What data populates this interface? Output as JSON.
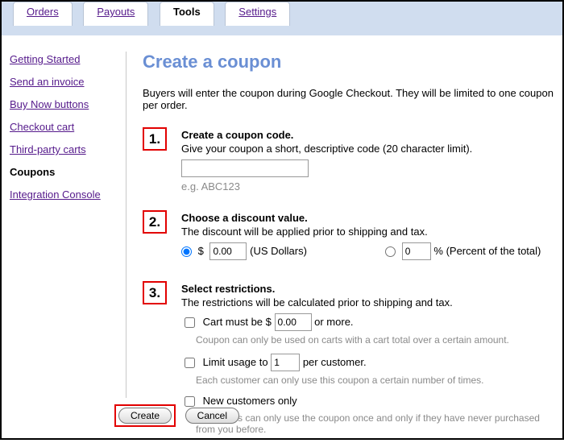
{
  "tabs": {
    "orders": "Orders",
    "payouts": "Payouts",
    "tools": "Tools",
    "settings": "Settings",
    "active": "tools"
  },
  "sidebar": {
    "items": [
      {
        "label": "Getting Started",
        "key": "getting-started"
      },
      {
        "label": "Send an invoice",
        "key": "send-invoice"
      },
      {
        "label": "Buy Now buttons",
        "key": "buy-now"
      },
      {
        "label": "Checkout cart",
        "key": "checkout-cart"
      },
      {
        "label": "Third-party carts",
        "key": "third-party"
      },
      {
        "label": "Coupons",
        "key": "coupons"
      },
      {
        "label": "Integration Console",
        "key": "integration"
      }
    ],
    "active": "coupons"
  },
  "page": {
    "title": "Create a coupon",
    "intro": "Buyers will enter the coupon during Google Checkout. They will be limited to one coupon per order."
  },
  "step1": {
    "num": "1.",
    "head": "Create a coupon code.",
    "sub": "Give your coupon a short, descriptive code (20 character limit).",
    "value": "",
    "hint": "e.g. ABC123"
  },
  "step2": {
    "num": "2.",
    "head": "Choose a discount value.",
    "sub": "The discount will be applied prior to shipping and tax.",
    "currency_symbol": "$",
    "dollar_value": "0.00",
    "dollar_suffix": "(US Dollars)",
    "pct_value": "0",
    "pct_suffix": "% (Percent of the total)",
    "selected": "dollar"
  },
  "step3": {
    "num": "3.",
    "head": "Select restrictions.",
    "sub": "The restrictions will be calculated prior to shipping and tax.",
    "cart_min": {
      "checked": false,
      "pre": "Cart must be $",
      "value": "0.00",
      "post": "or more.",
      "note": "Coupon can only be used on carts with a cart total over a certain amount."
    },
    "limit": {
      "checked": false,
      "pre": "Limit usage to",
      "value": "1",
      "post": "per customer.",
      "note": "Each customer can only use this coupon a certain number of times."
    },
    "newcust": {
      "checked": false,
      "label": "New customers only",
      "note": "Customers can only use the coupon once and only if they have never purchased from you before."
    }
  },
  "buttons": {
    "create": "Create",
    "cancel": "Cancel"
  }
}
